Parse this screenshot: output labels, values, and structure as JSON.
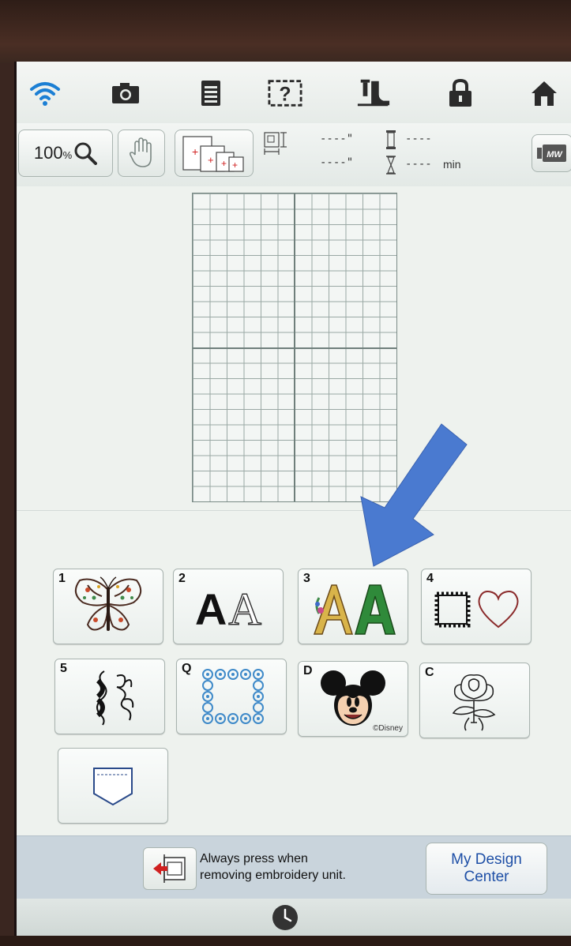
{
  "topbar": {
    "icons": [
      "wifi-icon",
      "camera-icon",
      "document-icon",
      "help-icon",
      "presser-foot-icon",
      "lock-icon",
      "home-icon"
    ]
  },
  "toolbar": {
    "zoom_value": "100",
    "zoom_unit": "%",
    "width_value": "----\"",
    "height_value": "----\"",
    "color_count": "----",
    "time_value": "----",
    "time_unit": "min",
    "mw_label": "MW"
  },
  "categories": [
    {
      "key": "1",
      "name": "embroidery-patterns",
      "icon": "butterfly-icon"
    },
    {
      "key": "2",
      "name": "alphabet-fonts",
      "icon": "letters-icon"
    },
    {
      "key": "3",
      "name": "decorative-alphabets",
      "icon": "decorative-letters-icon"
    },
    {
      "key": "4",
      "name": "frame-patterns",
      "icon": "frame-heart-icon"
    },
    {
      "key": "5",
      "name": "utility-patterns",
      "icon": "scroll-icon"
    },
    {
      "key": "Q",
      "name": "quilt-patterns",
      "icon": "quilt-frame-icon"
    },
    {
      "key": "D",
      "name": "disney-patterns",
      "icon": "mickey-icon",
      "caption": "©Disney"
    },
    {
      "key": "C",
      "name": "couching-patterns",
      "icon": "rose-icon"
    },
    {
      "key": "",
      "name": "pocket-patterns",
      "icon": "pocket-icon"
    }
  ],
  "bottombar": {
    "eject_message_line1": "Always press when",
    "eject_message_line2": "removing embroidery unit.",
    "design_center_line1": "My Design",
    "design_center_line2": "Center"
  },
  "colors": {
    "arrow": "#4a7ad0",
    "design_center_text": "#1e4fa6",
    "wifi": "#1c7fd4"
  }
}
